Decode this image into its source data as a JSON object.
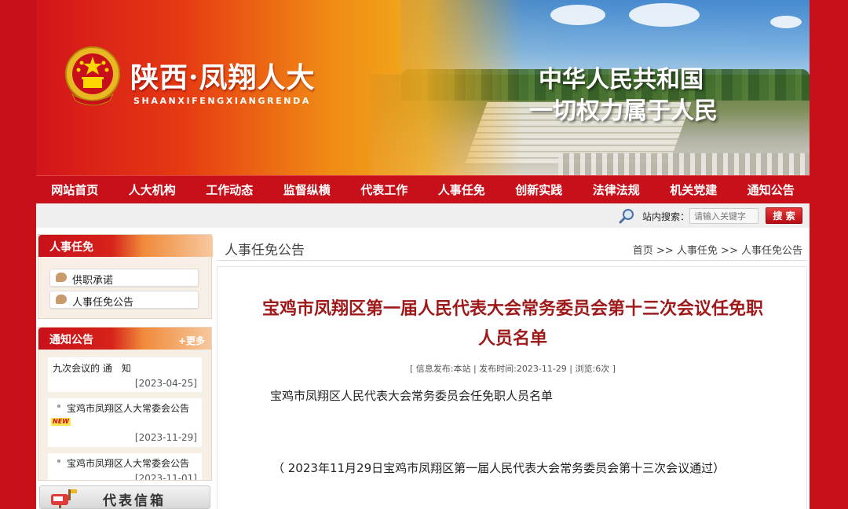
{
  "banner": {
    "site_name": "陕西·凤翔人大",
    "site_pinyin": "SHAANXIFENGXIANGRENDA",
    "slogan_line1": "中华人民共和国",
    "slogan_line2": "一切权力属于人民"
  },
  "nav": {
    "items": [
      "网站首页",
      "人大机构",
      "工作动态",
      "监督纵横",
      "代表工作",
      "人事任免",
      "创新实践",
      "法律法规",
      "机关党建",
      "通知公告"
    ]
  },
  "search": {
    "label": "站内搜索：",
    "placeholder": "请输入关键字",
    "button": "搜 索"
  },
  "sidebar": {
    "personnel": {
      "title": "人事任免",
      "links": [
        "供职承诺",
        "人事任免公告"
      ]
    },
    "notices": {
      "title": "通知公告",
      "more": "+更多",
      "items": [
        {
          "title": "九次会议的 通　知",
          "date": "[2023-04-25]"
        },
        {
          "title": "宝鸡市凤翔区人大常委会公告",
          "badge": "NEW",
          "date": "[2023-11-29]"
        },
        {
          "title": "宝鸡市凤翔区人大常委会公告",
          "date": "[2023-11-01]"
        }
      ]
    },
    "mailbox": "代表信箱"
  },
  "main": {
    "section_title": "人事任免公告",
    "breadcrumb": [
      "首页",
      ">>",
      "人事任免",
      ">>",
      "人事任免公告"
    ],
    "article": {
      "title_line1": "宝鸡市凤翔区第一届人民代表大会常务委员会第十三次会议任免职",
      "title_line2": "人员名单",
      "meta": "[ 信息发布:本站 | 发布时间:2023-11-29 | 浏览:6次 ]",
      "paragraph1": "宝鸡市凤翔区人民代表大会常务委员会任免职人员名单",
      "paragraph2": "（ 2023年11月29日宝鸡市凤翔区第一届人民代表大会常务委员会第十三次会议通过）"
    }
  },
  "colors": {
    "brand_red": "#c8101a",
    "title_red": "#9e1a1a"
  }
}
